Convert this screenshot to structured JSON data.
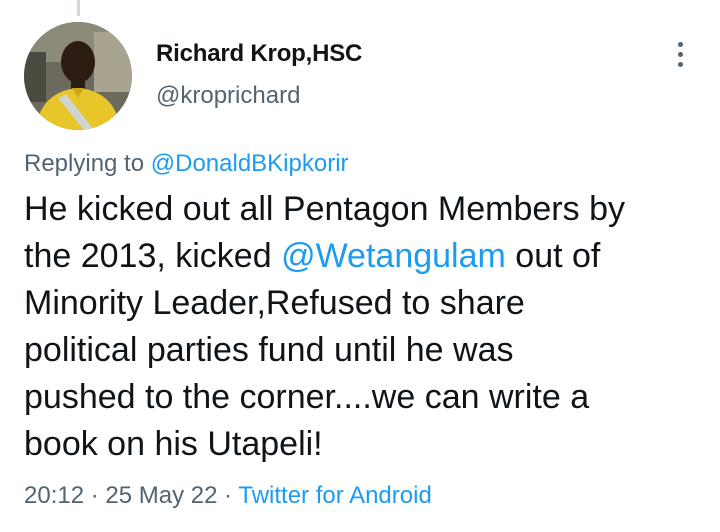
{
  "author": {
    "name": "Richard Krop,HSC",
    "handle": "@kroprichard"
  },
  "tweet": {
    "replying_prefix": "Replying to ",
    "replying_to": "@DonaldBKipkorir",
    "body_line1": "He kicked out all Pentagon Members by",
    "body_line2_before": "the 2013, kicked ",
    "mention": "@Wetangulam",
    "body_line2_after": " out of",
    "body_line3": "Minority Leader,Refused to share",
    "body_line4": "political parties fund until he was",
    "body_line5": "pushed to the corner....we can write a",
    "body_line6": "book on his Utapeli!"
  },
  "meta": {
    "time": "20:12",
    "separator1": " · ",
    "date": "25 May 22",
    "separator2": " · ",
    "source": "Twitter for Android"
  },
  "colors": {
    "link": "#1d9bf0",
    "secondary_text": "#536471",
    "primary_text": "#0f1419"
  },
  "icons": {
    "more": "more-vertical-icon"
  }
}
